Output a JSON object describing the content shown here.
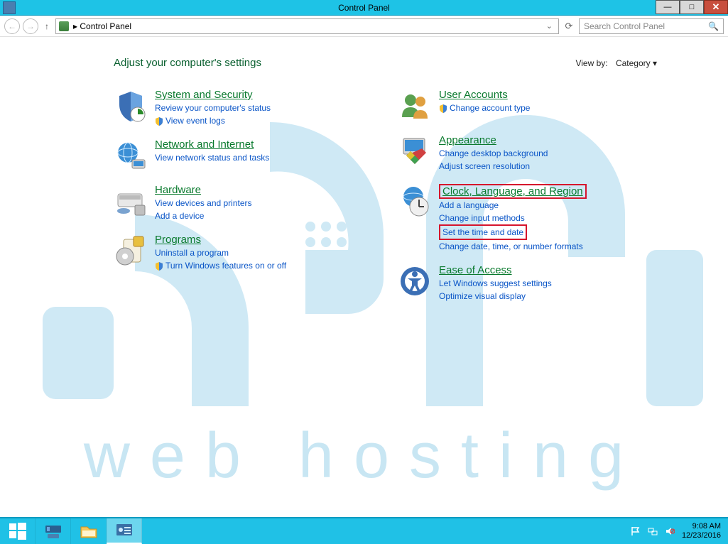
{
  "window": {
    "title": "Control Panel"
  },
  "addressbar": {
    "path": "Control Panel",
    "chevron": "▸"
  },
  "search": {
    "placeholder": "Search Control Panel"
  },
  "heading": "Adjust your computer's settings",
  "viewby": {
    "label": "View by:",
    "value": "Category"
  },
  "left": [
    {
      "title": "System and Security",
      "subs": [
        "Review your computer's status"
      ],
      "shielded": [
        "View event logs"
      ]
    },
    {
      "title": "Network and Internet",
      "subs": [
        "View network status and tasks"
      ]
    },
    {
      "title": "Hardware",
      "subs": [
        "View devices and printers",
        "Add a device"
      ]
    },
    {
      "title": "Programs",
      "subs": [
        "Uninstall a program"
      ],
      "shielded": [
        "Turn Windows features on or off"
      ]
    }
  ],
  "right": [
    {
      "title": "User Accounts",
      "shielded": [
        "Change account type"
      ]
    },
    {
      "title": "Appearance",
      "subs": [
        "Change desktop background",
        "Adjust screen resolution"
      ]
    },
    {
      "title": "Clock, Language, and Region",
      "boxed_title": true,
      "subs": [
        "Add a language",
        "Change input methods",
        "Set the time and date",
        "Change date, time, or number formats"
      ],
      "boxed_sub": 2
    },
    {
      "title": "Ease of Access",
      "subs": [
        "Let Windows suggest settings",
        "Optimize visual display"
      ]
    }
  ],
  "tray": {
    "time": "9:08 AM",
    "date": "12/23/2016"
  }
}
